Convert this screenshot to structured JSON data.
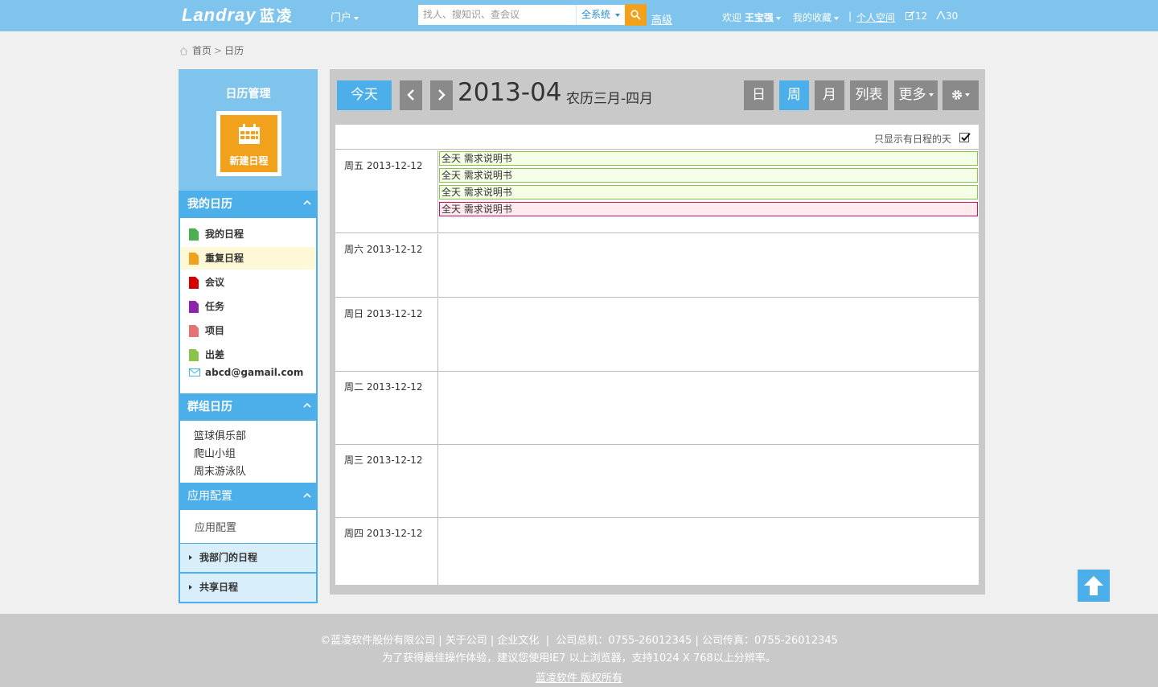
{
  "topbar": {
    "logo_en": "Landray",
    "logo_cn": "蓝凌",
    "portal_label": "门户",
    "search_placeholder": "找人、搜知识、查会议",
    "search_scope": "全系统",
    "advanced_label": "高级",
    "welcome_prefix": "欢迎",
    "user_name": "王宝强",
    "favorites_label": "我的收藏",
    "separator": "|",
    "personal_space_label": "个人空间",
    "edit_count": "12",
    "notify_count": "30"
  },
  "breadcrumb": {
    "home": "首页",
    "separator": ">",
    "current": "日历"
  },
  "sidebar": {
    "title": "日历管理",
    "new_event_label": "新建日程",
    "my_calendars": {
      "title": "我的日历",
      "items": [
        {
          "label": "我的日程",
          "color": "#4caf50"
        },
        {
          "label": "重复日程",
          "color": "#f2a11d"
        },
        {
          "label": "会议",
          "color": "#d50000"
        },
        {
          "label": "任务",
          "color": "#8e24aa"
        },
        {
          "label": "项目",
          "color": "#e57373"
        },
        {
          "label": "出差",
          "color": "#8bc34a"
        }
      ],
      "email": "abcd@gamail.com"
    },
    "group_calendars": {
      "title": "群组日历",
      "items": [
        "篮球俱乐部",
        "爬山小组",
        "周末游泳队"
      ]
    },
    "app_config": {
      "title": "应用配置",
      "item": "应用配置"
    },
    "dept_schedule": "我部门的日程",
    "shared_schedule": "共享日程"
  },
  "calendar": {
    "today_label": "今天",
    "current_month": "2013-04",
    "lunar_label": "农历三月-四月",
    "view_day": "日",
    "view_week": "周",
    "view_month": "月",
    "view_list": "列表",
    "more_label": "更多",
    "only_with_events_label": "只显示有日程的天",
    "only_with_events_checked": true,
    "days": [
      {
        "label": "周五 2013-12-12",
        "events": [
          {
            "text": "全天 需求说明书",
            "style": "green"
          },
          {
            "text": "全天 需求说明书",
            "style": "green"
          },
          {
            "text": "全天 需求说明书",
            "style": "green"
          },
          {
            "text": "全天 需求说明书",
            "style": "pink"
          }
        ]
      },
      {
        "label": "周六 2013-12-12",
        "events": []
      },
      {
        "label": "周日 2013-12-12",
        "events": []
      },
      {
        "label": "周二 2013-12-12",
        "events": []
      },
      {
        "label": "周三 2013-12-12",
        "events": []
      },
      {
        "label": "周四 2013-12-12",
        "events": []
      }
    ]
  },
  "footer": {
    "copyright": "©蓝凌软件股份有限公司",
    "about": "关于公司",
    "culture": "企业文化",
    "phone": "公司总机：0755-26012345",
    "fax": "公司传真：0755-26012345",
    "browser_notice": "为了获得最佳操作体验，建议您使用IE7 以上浏览器，支持1024 X 768以上分辨率。",
    "rights": "蓝凌软件 版权所有"
  },
  "colors": {
    "accent": "#4dafea",
    "topbar": "#7fc4ec",
    "orange": "#f2a11d",
    "gray_button": "#8a8a8a"
  }
}
